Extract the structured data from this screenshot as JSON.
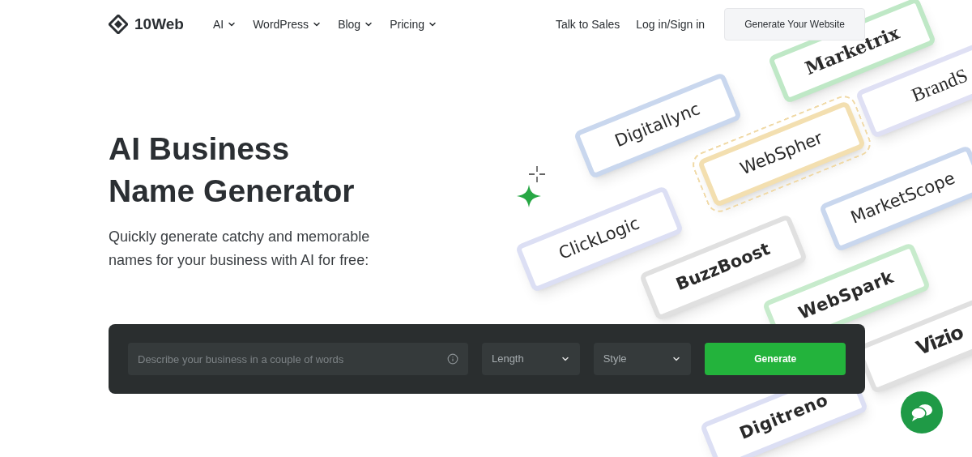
{
  "header": {
    "logo": "10Web",
    "nav": [
      {
        "label": "AI"
      },
      {
        "label": "WordPress"
      },
      {
        "label": "Blog"
      },
      {
        "label": "Pricing"
      }
    ],
    "links": [
      "Talk to Sales",
      "Log in/Sign in"
    ],
    "cta": "Generate Your Website"
  },
  "hero": {
    "title_lines": [
      "AI Business",
      "Name Generator"
    ],
    "subtitle_lines": [
      "Quickly generate catchy and memorable",
      "names for your business with AI for free:"
    ]
  },
  "form": {
    "placeholder": "Describe your business in a couple of words",
    "selects": [
      {
        "label": "Length"
      },
      {
        "label": "Style"
      }
    ],
    "button": "Generate"
  },
  "cards": [
    {
      "name": "Marketrix",
      "kind": "slab",
      "color": "#bfe8c6",
      "selected": false
    },
    {
      "name": "BrandS",
      "kind": "serif",
      "color": "#dfe0f4",
      "selected": false
    },
    {
      "name": "Digitallync",
      "kind": "sans",
      "color": "#c9d7ee",
      "selected": false
    },
    {
      "name": "WebSpher",
      "kind": "sans",
      "color": "#f3dfb0",
      "selected": true
    },
    {
      "name": "MarketScope",
      "kind": "sans",
      "color": "#c9d7ee",
      "selected": false
    },
    {
      "name": "ClickLogic",
      "kind": "sans",
      "color": "#dcdff4",
      "selected": false
    },
    {
      "name": "BuzzBoost",
      "kind": "heavy",
      "color": "#e0e0e0",
      "selected": false
    },
    {
      "name": "WebSpark",
      "kind": "round",
      "color": "#c7ebcc",
      "selected": false
    },
    {
      "name": "Vizio",
      "kind": "condensed",
      "color": "#e0e0e0",
      "selected": false
    },
    {
      "name": "Digitreno",
      "kind": "round",
      "color": "#dcdff4",
      "selected": false
    }
  ]
}
